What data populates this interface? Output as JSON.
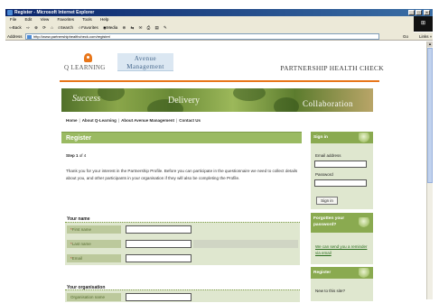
{
  "browser": {
    "title": "Register - Microsoft Internet Explorer",
    "menu": [
      "File",
      "Edit",
      "View",
      "Favorites",
      "Tools",
      "Help"
    ],
    "toolbar": [
      "⇦Back",
      "⇨",
      "⊗",
      "⟳",
      "⌂",
      "⌕Search",
      "☆Favorites",
      "◉Media",
      "⊛",
      "⇆",
      "✉",
      "⎙",
      "▤",
      "✎"
    ],
    "address_label": "Address",
    "url": "http://www.partnershiphealthcheck.com/register/",
    "go_label": "Go",
    "links_label": "Links »",
    "window_buttons": [
      "_",
      "□",
      "×"
    ]
  },
  "site": {
    "logo_text": "Q LEARNING",
    "avenue_line1": "Avenue",
    "avenue_line2": "Management",
    "title": "PARTNERSHIP HEALTH CHECK",
    "banner": [
      "Success",
      "Delivery",
      "Collaboration"
    ],
    "nav": [
      "Home",
      "About Q-Learning",
      "About Avenue Management",
      "Contact Us"
    ],
    "accent_color": "#e8761a",
    "green_color": "#9aba62"
  },
  "register": {
    "heading": "Register",
    "step_label": "Step 1",
    "step_suffix": "of 4",
    "intro": "Thank you for your interest in the Partnership Profile. Before you can participate in the questionnaire we need to collect details about you, and other participants in your organisation if they will also be completing the Profile.",
    "your_name_title": "Your name",
    "fields": [
      {
        "label": "First name",
        "required": "*"
      },
      {
        "label": "Last name",
        "required": "*"
      },
      {
        "label": "Email",
        "required": "*"
      }
    ],
    "your_org_title": "Your organisation",
    "org_field_label": "Organisation name"
  },
  "sidebar": {
    "signin_title": "Sign in",
    "email_label": "Email address",
    "password_label": "Password",
    "signin_button": "Sign in",
    "forgot_title": "Forgotten your password?",
    "forgot_link": "We can send you a reminder via email",
    "register_title": "Register",
    "new_to_site": "New to this site?"
  }
}
